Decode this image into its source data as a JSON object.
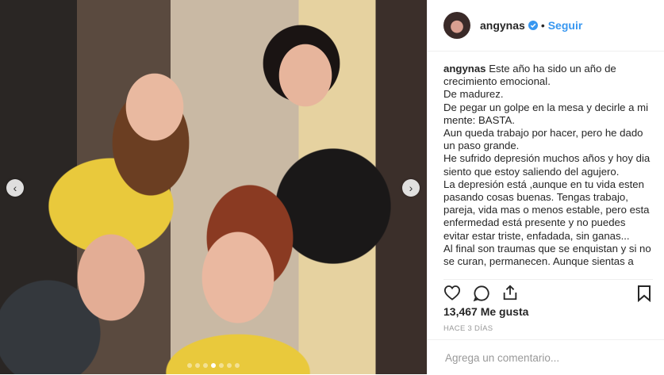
{
  "post": {
    "username": "angynas",
    "separator": "•",
    "follow_label": "Seguir",
    "caption_lines": [
      "Este año ha sido un año de crecimiento emocional.",
      "De madurez.",
      "De pegar un golpe en la mesa y decirle a mi mente: BASTA.",
      "Aun queda trabajo por hacer, pero he dado un paso grande.",
      "He sufrido depresión muchos años y hoy dia siento que estoy saliendo del agujero.",
      "La depresión está ,aunque en tu vida esten pasando cosas buenas. Tengas trabajo, pareja, vida mas o menos estable, pero esta enfermedad está presente y no puedes evitar estar triste, enfadada, sin ganas...",
      "Al final son traumas que se enquistan y si no se curan, permanecen. Aunque sientas a"
    ],
    "likes": "13,467 Me gusta",
    "time_ago": "HACE 3 DÍAS",
    "comment_placeholder": "Agrega un comentario...",
    "carousel": {
      "count": 7,
      "active_index": 3
    }
  },
  "icons": {
    "verified": "verified-badge-icon",
    "like": "heart-icon",
    "comment": "comment-bubble-icon",
    "share": "share-icon",
    "save": "bookmark-icon",
    "prev": "chevron-left-icon",
    "next": "chevron-right-icon"
  },
  "colors": {
    "accent": "#3897f0",
    "text": "#262626",
    "muted": "#999999"
  }
}
